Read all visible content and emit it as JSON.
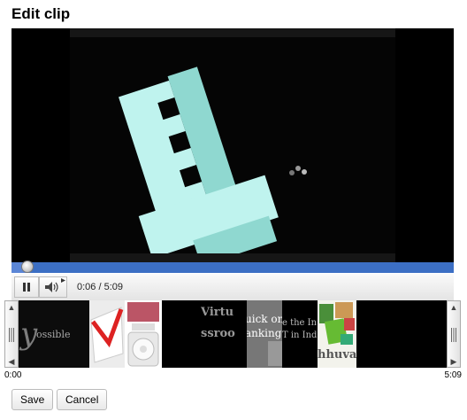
{
  "page": {
    "title": "Edit clip"
  },
  "player": {
    "progress_fraction": 0.035,
    "time_display": "0:06 / 5:09"
  },
  "filmstrip": {
    "start_label": "0:00",
    "end_label": "5:09",
    "thumb_texts": {
      "t1": "ossible",
      "t2": "Virtu",
      "t3": "ssroo",
      "t4": "uick on",
      "t5": "anking",
      "t6": "e the In",
      "t7": "T in  Ind",
      "t8": "hhuva"
    }
  },
  "actions": {
    "save_label": "Save",
    "cancel_label": "Cancel"
  },
  "colors": {
    "progress_bar": "#3c6fc4",
    "video_text": "#bff3ee"
  }
}
